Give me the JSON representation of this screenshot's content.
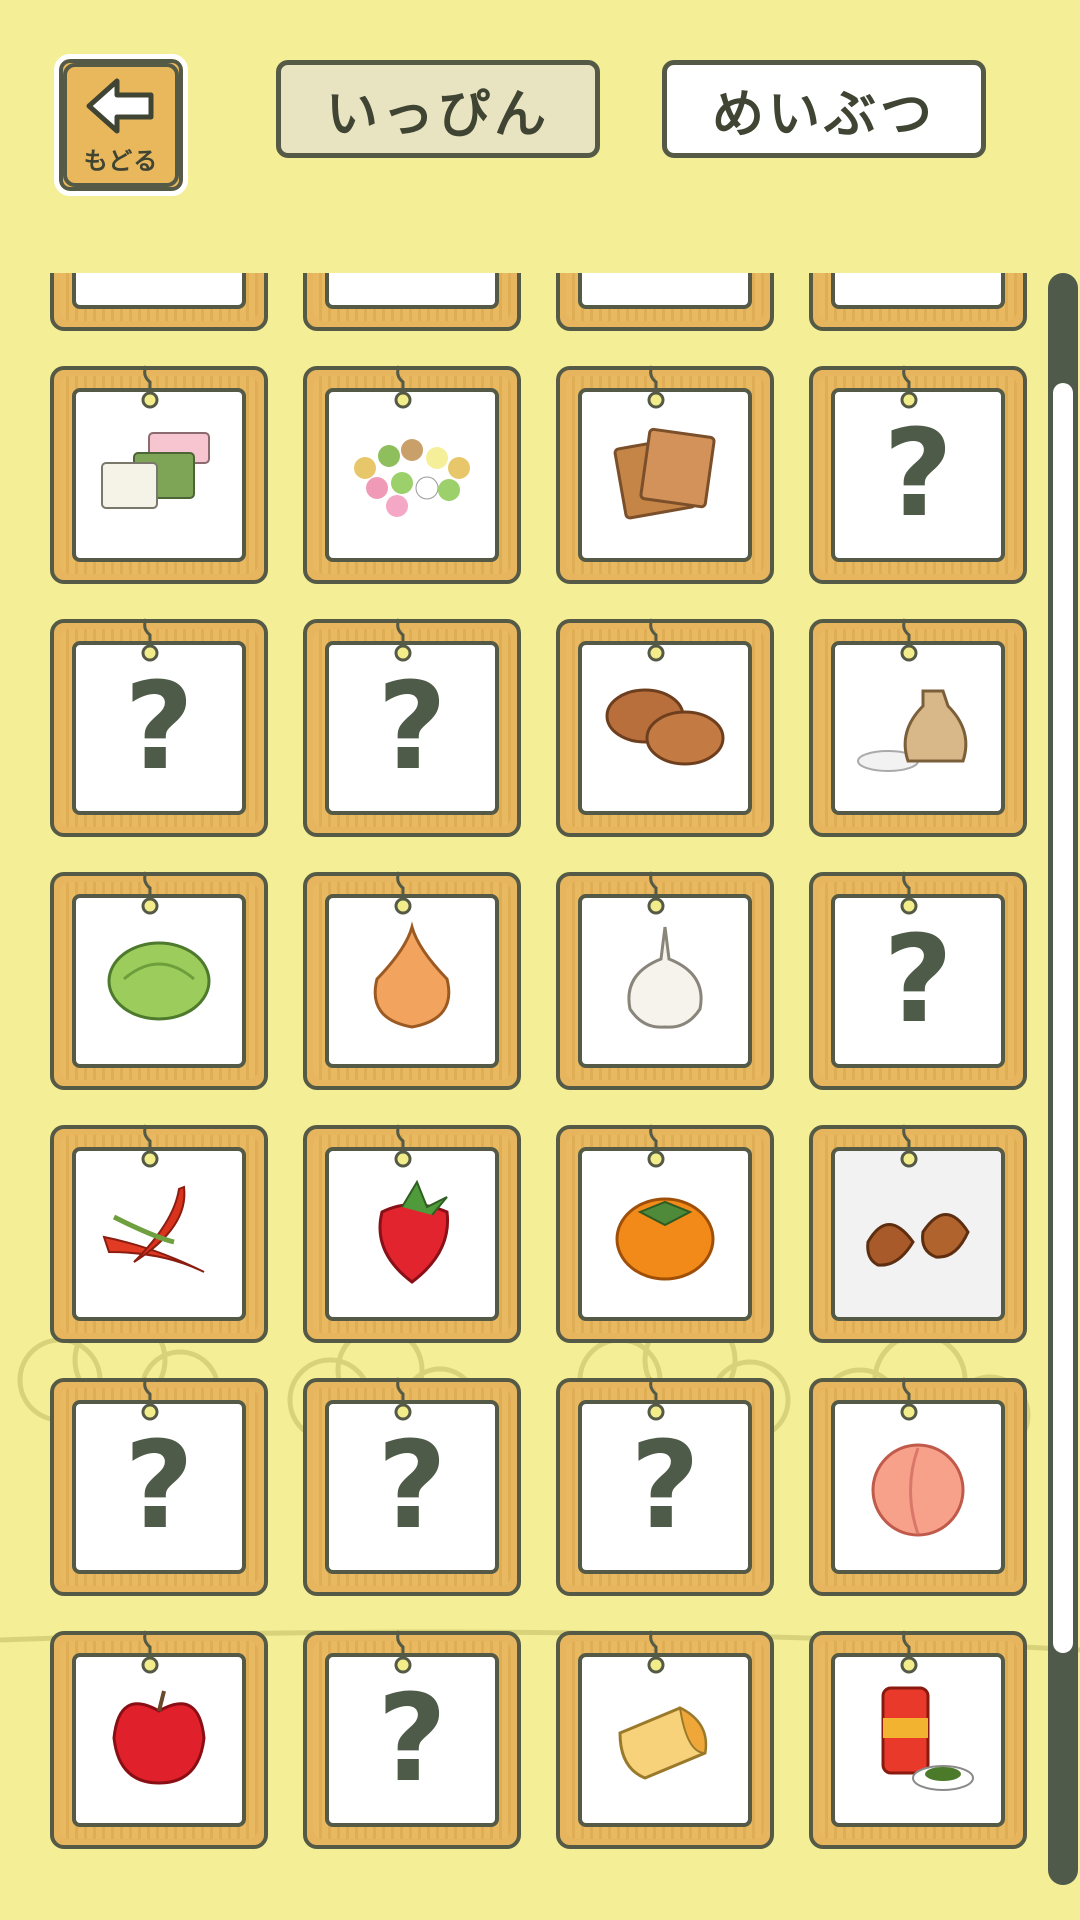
{
  "header": {
    "back_label": "もどる",
    "tabs": [
      {
        "label": "いっぴん",
        "selected": true
      },
      {
        "label": "めいぶつ",
        "selected": false
      }
    ]
  },
  "colors": {
    "background": "#f4ef97",
    "wood": "#e6b55d",
    "outline": "#555a47",
    "card_face": "#ffffff"
  },
  "items": [
    {
      "icon": "unknown-icon",
      "unknown": true
    },
    {
      "icon": "skewer-icon",
      "unknown": false
    },
    {
      "icon": "unknown-icon",
      "unknown": true
    },
    {
      "icon": "grilled-skewer-icon",
      "unknown": false
    },
    {
      "icon": "layered-sweets-icon",
      "unknown": false
    },
    {
      "icon": "colorful-dumplings-icon",
      "unknown": false
    },
    {
      "icon": "rice-crackers-icon",
      "unknown": false
    },
    {
      "icon": "unknown-icon",
      "unknown": true
    },
    {
      "icon": "unknown-icon",
      "unknown": true
    },
    {
      "icon": "unknown-icon",
      "unknown": true
    },
    {
      "icon": "manju-buns-icon",
      "unknown": false
    },
    {
      "icon": "rice-bag-icon",
      "unknown": false
    },
    {
      "icon": "cabbage-icon",
      "unknown": false
    },
    {
      "icon": "onion-icon",
      "unknown": false
    },
    {
      "icon": "garlic-icon",
      "unknown": false
    },
    {
      "icon": "unknown-icon",
      "unknown": true
    },
    {
      "icon": "chili-peppers-icon",
      "unknown": false
    },
    {
      "icon": "strawberry-icon",
      "unknown": false
    },
    {
      "icon": "persimmon-icon",
      "unknown": false
    },
    {
      "icon": "chestnuts-icon",
      "unknown": false,
      "gray": true
    },
    {
      "icon": "unknown-icon",
      "unknown": true
    },
    {
      "icon": "unknown-icon",
      "unknown": true
    },
    {
      "icon": "unknown-icon",
      "unknown": true
    },
    {
      "icon": "peach-icon",
      "unknown": false
    },
    {
      "icon": "apple-icon",
      "unknown": false
    },
    {
      "icon": "unknown-icon",
      "unknown": true
    },
    {
      "icon": "cheese-icon",
      "unknown": false
    },
    {
      "icon": "tea-canister-icon",
      "unknown": false
    }
  ],
  "unknown_symbol": "?"
}
